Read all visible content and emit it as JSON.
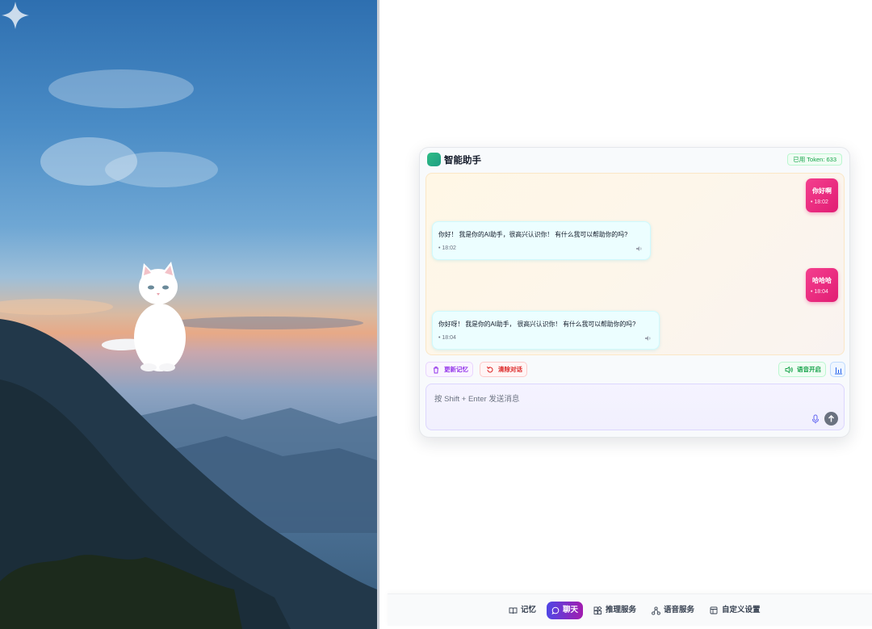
{
  "chat": {
    "title": "智能助手",
    "token_label": "已用 Token: 633",
    "messages": [
      {
        "role": "user",
        "text": "你好啊",
        "time": "18:02"
      },
      {
        "role": "assistant",
        "text": "你好！ 我是你的AI助手，很高兴认识你！ 有什么我可以帮助你的吗?",
        "time": "18:02"
      },
      {
        "role": "user",
        "text": "哈哈哈",
        "time": "18:04"
      },
      {
        "role": "assistant",
        "text": "你好呀！ 我是你的AI助手， 很高兴认识你！ 有什么我可以帮助你的吗?",
        "time": "18:04"
      }
    ],
    "actions": {
      "update_memory": "更新记忆",
      "clear_chat": "清除对话",
      "voice_on": "语音开启"
    },
    "input": {
      "placeholder": "按 Shift + Enter 发送消息",
      "value": ""
    }
  },
  "nav": {
    "items": [
      {
        "label": "记忆",
        "icon": "book-icon"
      },
      {
        "label": "聊天",
        "icon": "chat-icon",
        "active": true
      },
      {
        "label": "推理服务",
        "icon": "apps-icon"
      },
      {
        "label": "语音服务",
        "icon": "nodes-icon"
      },
      {
        "label": "自定义设置",
        "icon": "layout-icon"
      }
    ]
  },
  "colors": {
    "accent_user_bubble": "#e11d74",
    "accent_nav_active": "#4f46e5",
    "assistant_bubble": "#ecfeff",
    "token_badge": "#16a34a"
  }
}
